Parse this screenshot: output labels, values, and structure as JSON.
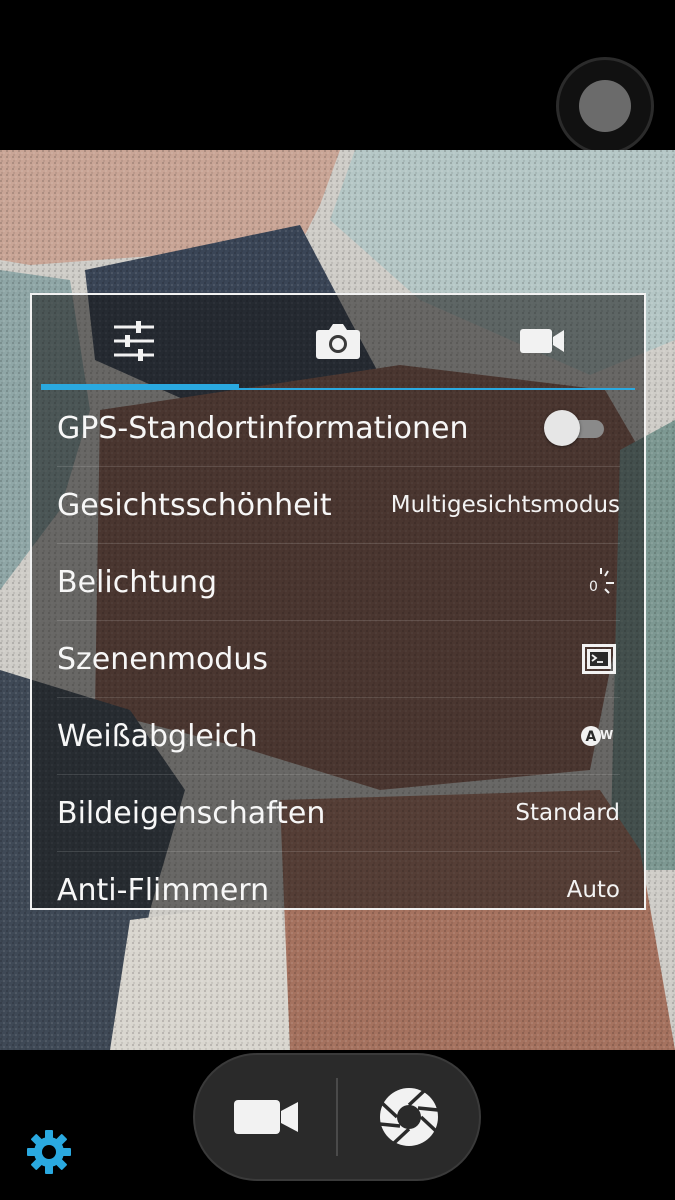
{
  "panel": {
    "tabs": [
      {
        "name": "settings-general-tab",
        "icon": "sliders-icon",
        "active": true
      },
      {
        "name": "photo-settings-tab",
        "icon": "camera-icon",
        "active": false
      },
      {
        "name": "video-settings-tab",
        "icon": "video-camera-icon",
        "active": false
      }
    ],
    "rows": {
      "gps": {
        "label": "GPS-Standortinformationen",
        "value": "off",
        "control": "toggle"
      },
      "beauty": {
        "label": "Gesichtsschönheit",
        "value": "Multigesichtsmodus"
      },
      "exposure": {
        "label": "Belichtung",
        "value_icon": "exposure-icon",
        "value_text": "0"
      },
      "scene": {
        "label": "Szenenmodus",
        "value_icon": "scene-mode-icon"
      },
      "white_balance": {
        "label": "Weißabgleich",
        "value_icon": "auto-white-balance-icon",
        "value_text": "AW"
      },
      "image_props": {
        "label": "Bildeigenschaften",
        "value": "Standard"
      },
      "anti_flicker": {
        "label": "Anti-Flimmern",
        "value": "Auto"
      }
    }
  },
  "bottom_bar": {
    "video_mode_icon": "video-camera-icon",
    "shutter_icon": "aperture-icon",
    "settings_icon": "gear-icon"
  },
  "colors": {
    "accent": "#2aa9e0",
    "panel_border": "#f2f2f2",
    "bar_background": "#000000"
  }
}
